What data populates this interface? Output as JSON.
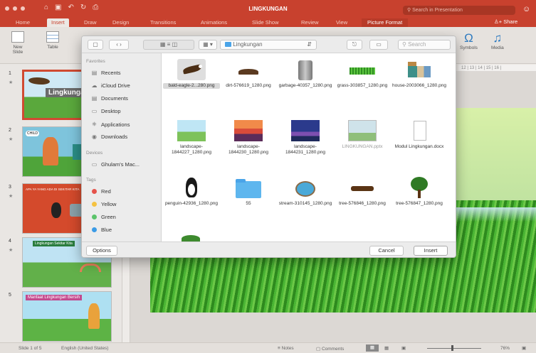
{
  "titlebar": {
    "doc_title": "LINGKUNGAN",
    "search_placeholder": "Search in Presentation",
    "qa_icons": [
      "home-icon",
      "save-icon",
      "undo-icon",
      "redo-icon",
      "print-icon"
    ]
  },
  "tabs": {
    "items": [
      "Home",
      "Insert",
      "Draw",
      "Design",
      "Transitions",
      "Animations",
      "Slide Show",
      "Review",
      "View",
      "Picture Format"
    ],
    "active": "Insert",
    "share": "Share"
  },
  "ribbon": {
    "new_slide": "New Slide",
    "table": "Table",
    "symbols": "Symbols",
    "media": "Media"
  },
  "ruler": "12 | 13 | 14 | 15 | 16 |",
  "thumbs": [
    {
      "num": "1",
      "text": "lingkungan"
    },
    {
      "num": "2",
      "text": "CHILD"
    },
    {
      "num": "3",
      "text": "APA YA YANG ADA DI SEKITAR KITA"
    },
    {
      "num": "4",
      "text": "Lingkungan Sekitar Kita"
    },
    {
      "num": "5",
      "text": "Manfaat Lingkungan Bersih"
    }
  ],
  "statusbar": {
    "slide": "Slide 1 of 5",
    "lang": "English (United States)",
    "notes": "Notes",
    "comments": "Comments",
    "zoom": "76%"
  },
  "dialog": {
    "location": "Lingkungan",
    "search_placeholder": "Search",
    "sidebar": {
      "favorites_header": "Favorites",
      "favorites": [
        {
          "label": "Recents",
          "icon": "recents-icon"
        },
        {
          "label": "iCloud Drive",
          "icon": "cloud-icon"
        },
        {
          "label": "Documents",
          "icon": "documents-icon"
        },
        {
          "label": "Desktop",
          "icon": "desktop-icon"
        },
        {
          "label": "Applications",
          "icon": "applications-icon"
        },
        {
          "label": "Downloads",
          "icon": "downloads-icon"
        }
      ],
      "devices_header": "Devices",
      "devices": [
        {
          "label": "Ghulam's Mac...",
          "icon": "computer-icon"
        }
      ],
      "tags_header": "Tags",
      "tags": [
        {
          "label": "Red",
          "color": "#e5534b"
        },
        {
          "label": "Yellow",
          "color": "#f5c242"
        },
        {
          "label": "Green",
          "color": "#5cc46b"
        },
        {
          "label": "Blue",
          "color": "#3b9be6"
        }
      ]
    },
    "files": [
      {
        "name": "bald-eagle-2...280.png",
        "icon": "eagle-thumbnail",
        "selected": true
      },
      {
        "name": "dirt-576619_1280.png",
        "icon": "dirt-thumbnail"
      },
      {
        "name": "garbage-40357_1280.png",
        "icon": "trash-can-thumbnail"
      },
      {
        "name": "grass-303857_1280.png",
        "icon": "grass-thumbnail"
      },
      {
        "name": "house-2003066_1280.png",
        "icon": "house-thumbnail"
      },
      {
        "name": "landscape-1844227_1280.png",
        "icon": "landscape-thumbnail"
      },
      {
        "name": "landscape-1844230_1280.png",
        "icon": "sunset-thumbnail"
      },
      {
        "name": "landscape-1844231_1280.png",
        "icon": "night-thumbnail"
      },
      {
        "name": "LINGKUNGAN.pptx",
        "icon": "pptx-thumbnail"
      },
      {
        "name": "Modul Lingkungan.docx",
        "icon": "docx-thumbnail"
      },
      {
        "name": "penguin-42936_1280.png",
        "icon": "penguin-thumbnail"
      },
      {
        "name": "55",
        "icon": "folder-icon"
      },
      {
        "name": "stream-310145_1280.png",
        "icon": "stream-thumbnail"
      },
      {
        "name": "tree-576846_1280.png",
        "icon": "log-thumbnail"
      },
      {
        "name": "tree-576847_1280.png",
        "icon": "tree-thumbnail"
      }
    ],
    "options": "Options",
    "cancel": "Cancel",
    "insert": "Insert"
  }
}
